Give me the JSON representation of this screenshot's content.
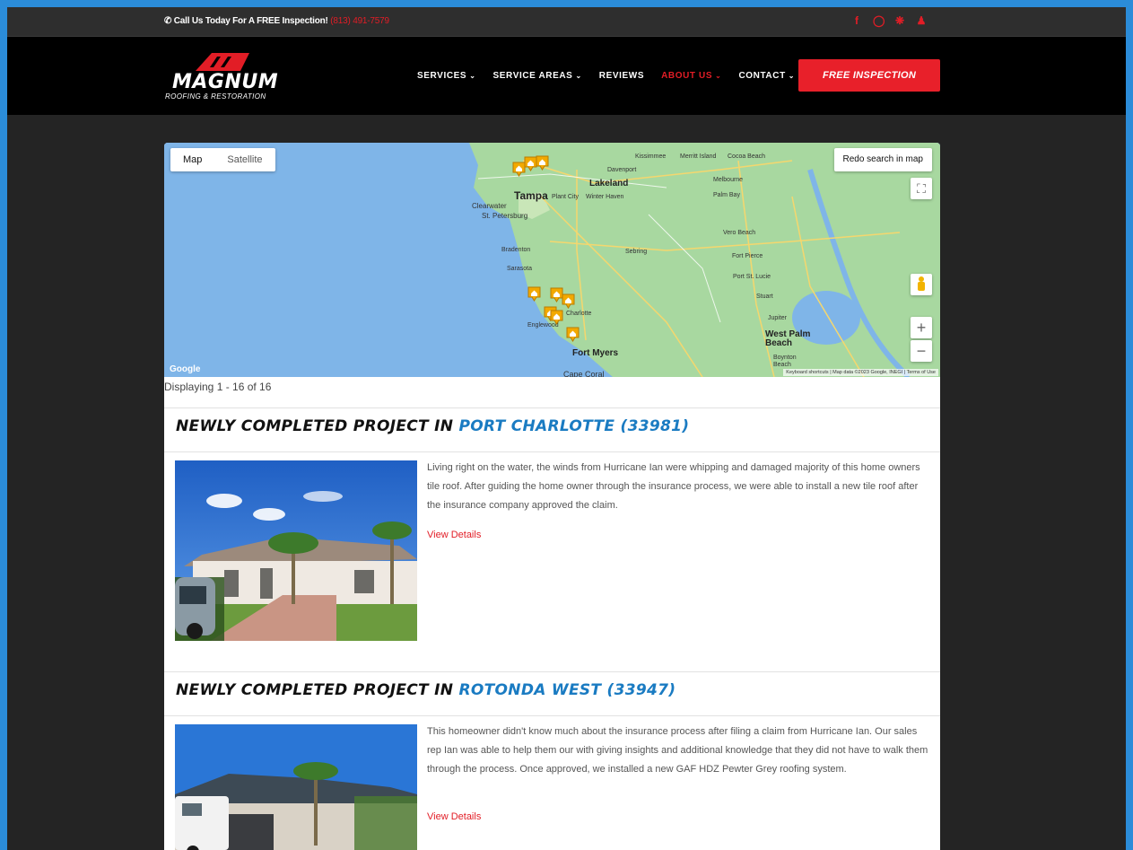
{
  "topbar": {
    "call_text": "Call Us Today For A FREE Inspection!",
    "phone": "(813) 491-7579",
    "social_icons": [
      "facebook-icon",
      "instagram-icon",
      "yelp-icon",
      "person-icon"
    ]
  },
  "header": {
    "logo_text": "MAGNUM",
    "logo_tagline": "ROOFING & RESTORATION",
    "nav": [
      {
        "label": "SERVICES",
        "dropdown": true
      },
      {
        "label": "SERVICE AREAS",
        "dropdown": true
      },
      {
        "label": "REVIEWS",
        "dropdown": false
      },
      {
        "label": "ABOUT US",
        "dropdown": true,
        "active": true
      },
      {
        "label": "CONTACT",
        "dropdown": true
      }
    ],
    "cta": "FREE INSPECTION"
  },
  "map": {
    "toggle": [
      "Map",
      "Satellite"
    ],
    "selected": "Map",
    "redo": "Redo search in map",
    "google": "Google",
    "footer": "Keyboard shortcuts | Map data ©2023 Google, INEGI | Terms of Use",
    "labels": {
      "kissimmee": "Kissimmee",
      "merritt": "Merritt Island",
      "cocoa": "Cocoa Beach",
      "davenport": "Davenport",
      "lakeland": "Lakeland",
      "melbourne": "Melbourne",
      "tampa": "Tampa",
      "plant": "Plant City",
      "winter": "Winter Haven",
      "palmbay": "Palm Bay",
      "clearwater": "Clearwater",
      "stpete": "St. Petersburg",
      "vero": "Vero Beach",
      "bradenton": "Bradenton",
      "sebring": "Sebring",
      "fortpierce": "Fort Pierce",
      "sarasota": "Sarasota",
      "portstlucie": "Port St. Lucie",
      "stuart": "Stuart",
      "charlotte": "Charlotte",
      "englewood": "Englewood",
      "jupiter": "Jupiter",
      "westpalm": "West Palm Beach",
      "fortmyers": "Fort Myers",
      "boynton": "Boynton Beach",
      "capecoral": "Cape Coral"
    },
    "colors": {
      "water": "#7fb5e8",
      "land": "#a8d8a0",
      "road": "#f5d76e",
      "pin": "#f2a900"
    }
  },
  "results": {
    "displaying": "Displaying 1 - 16 of 16"
  },
  "projects": [
    {
      "title_prefix": "NEWLY COMPLETED PROJECT IN ",
      "location": "PORT CHARLOTTE (33981)",
      "description": "Living right on the water, the winds from Hurricane Ian were whipping and damaged majority of this home owners tile roof. After guiding the home owner through the insurance process, we were able to install a new tile roof after the insurance company approved the claim.",
      "link": "View Details"
    },
    {
      "title_prefix": "NEWLY COMPLETED PROJECT IN ",
      "location": "ROTONDA WEST (33947)",
      "description": "This homeowner didn't know much about the insurance process after filing a claim from Hurricane Ian. Our sales rep Ian was able to help them our with giving insights and additional knowledge that they did not have to walk them through the process. Once approved, we installed a new GAF HDZ Pewter Grey roofing system.",
      "link": "View Details"
    }
  ]
}
